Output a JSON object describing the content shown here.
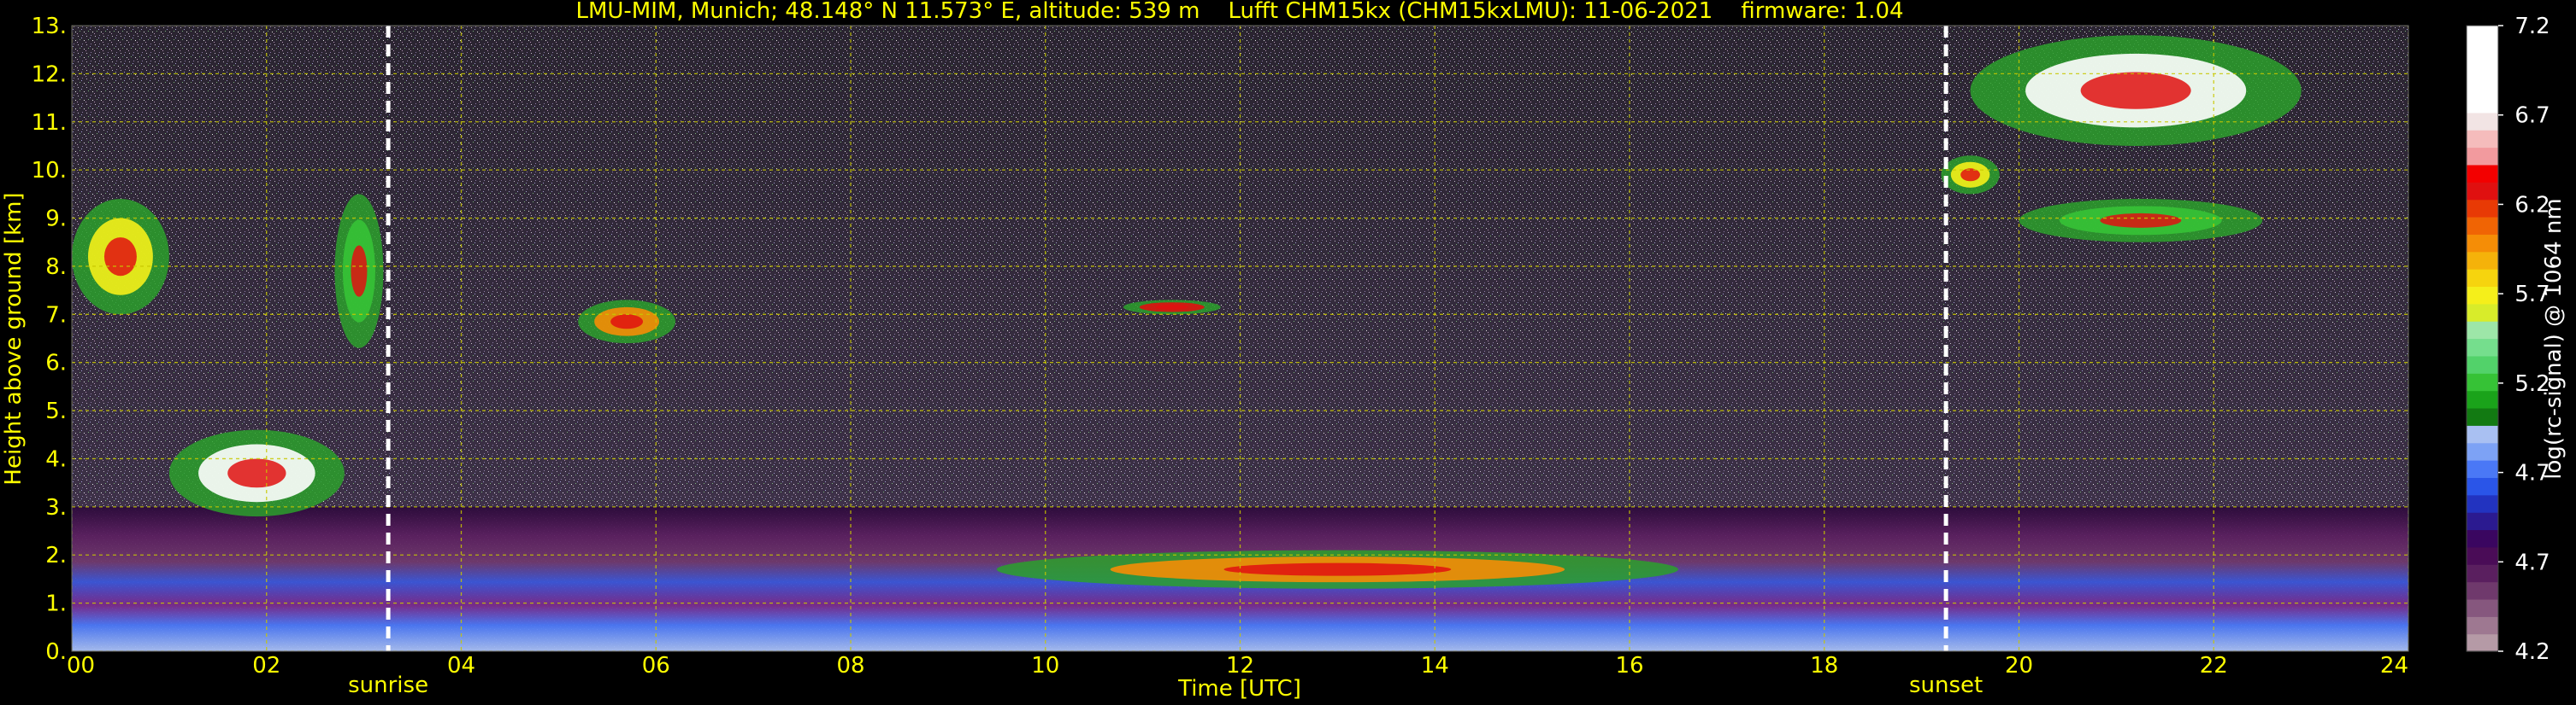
{
  "chart_data": {
    "type": "heatmap",
    "title": "LMU-MIM, Munich; 48.148° N 11.573° E, altitude: 539 m    Lufft CHM15kx (CHM15kxLMU): 11-06-2021    firmware: 1.04",
    "xlabel": "Time [UTC]",
    "ylabel": "Height above ground [km]",
    "xlim": [
      0,
      24
    ],
    "ylim": [
      0,
      13
    ],
    "x_ticks": [
      "00",
      "02",
      "04",
      "06",
      "08",
      "10",
      "12",
      "14",
      "16",
      "18",
      "20",
      "22",
      "24"
    ],
    "y_ticks": [
      "0.",
      "1.",
      "2.",
      "3.",
      "4.",
      "5.",
      "6.",
      "7.",
      "8.",
      "9.",
      "10.",
      "11.",
      "12.",
      "13."
    ],
    "grid": true,
    "annotations": [
      {
        "label": "sunrise",
        "x": 3.25
      },
      {
        "label": "sunset",
        "x": 19.25
      }
    ],
    "colorbar": {
      "label": "log(rc-signal) @ 1064 nm",
      "range": [
        4.2,
        7.2
      ],
      "ticks": [
        "4.2",
        "4.7",
        "4.7",
        "5.2",
        "5.7",
        "6.2",
        "6.7",
        "7.2"
      ],
      "colors": [
        "#b59aa6",
        "#9e7891",
        "#86577e",
        "#6f396c",
        "#5a1f5f",
        "#4a0c57",
        "#3a0660",
        "#2b1a90",
        "#2233c0",
        "#2a55e8",
        "#4a78f6",
        "#7da2f5",
        "#a9c0f2",
        "#127a12",
        "#1aa31a",
        "#36c236",
        "#52d26a",
        "#75de8d",
        "#9de6a8",
        "#d8ec2a",
        "#f5ef1a",
        "#f6d40e",
        "#f5b20a",
        "#f58d06",
        "#f06404",
        "#e83a05",
        "#e01010",
        "#f30000",
        "#f29a9e",
        "#f5bcbc",
        "#f2e4e4",
        "#ffffff",
        "#ffffff",
        "#ffffff",
        "#ffffff",
        "#ffffff"
      ]
    },
    "features": [
      {
        "kind": "boundary_layer",
        "x": [
          0,
          24
        ],
        "y": [
          0,
          3.0
        ]
      },
      {
        "kind": "cloud",
        "x": [
          0.0,
          1.0
        ],
        "y": [
          7.0,
          9.4
        ]
      },
      {
        "kind": "cloud",
        "x": [
          2.7,
          3.2
        ],
        "y": [
          6.3,
          9.5
        ]
      },
      {
        "kind": "cloud",
        "x": [
          1.0,
          2.8
        ],
        "y": [
          2.8,
          4.6
        ]
      },
      {
        "kind": "cloud",
        "x": [
          5.2,
          6.2
        ],
        "y": [
          6.4,
          7.3
        ]
      },
      {
        "kind": "cloud",
        "x": [
          10.8,
          11.8
        ],
        "y": [
          7.0,
          7.3
        ]
      },
      {
        "kind": "cloud",
        "x": [
          19.2,
          19.8
        ],
        "y": [
          9.5,
          10.3
        ]
      },
      {
        "kind": "cloud",
        "x": [
          20.0,
          22.5
        ],
        "y": [
          8.5,
          9.4
        ]
      },
      {
        "kind": "cloud",
        "x": [
          19.5,
          22.9
        ],
        "y": [
          10.5,
          12.8
        ]
      },
      {
        "kind": "cloud",
        "x": [
          9.5,
          16.5
        ],
        "y": [
          1.3,
          2.1
        ]
      }
    ]
  }
}
